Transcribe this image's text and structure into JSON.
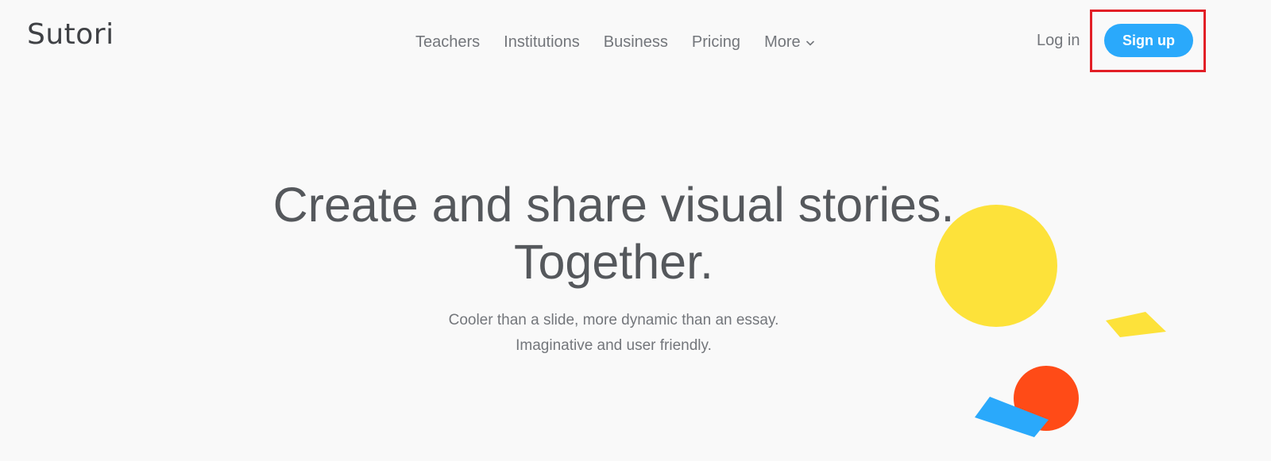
{
  "brand": {
    "name": "Sutori"
  },
  "nav": {
    "items": [
      {
        "label": "Teachers"
      },
      {
        "label": "Institutions"
      },
      {
        "label": "Business"
      },
      {
        "label": "Pricing"
      },
      {
        "label": "More",
        "icon": "chevron-down-icon"
      }
    ],
    "login_label": "Log in",
    "signup_label": "Sign up"
  },
  "hero": {
    "headline_line1": "Create and share visual stories.",
    "headline_line2": "Together.",
    "subtext_line1": "Cooler than a slide, more dynamic than an essay.",
    "subtext_line2": "Imaginative and user friendly."
  },
  "colors": {
    "background": "#f9f9f9",
    "accent_blue": "#2aa9fb",
    "highlight_red": "#e21f26",
    "yellow": "#fde23a",
    "orange_red": "#ff4b17"
  }
}
